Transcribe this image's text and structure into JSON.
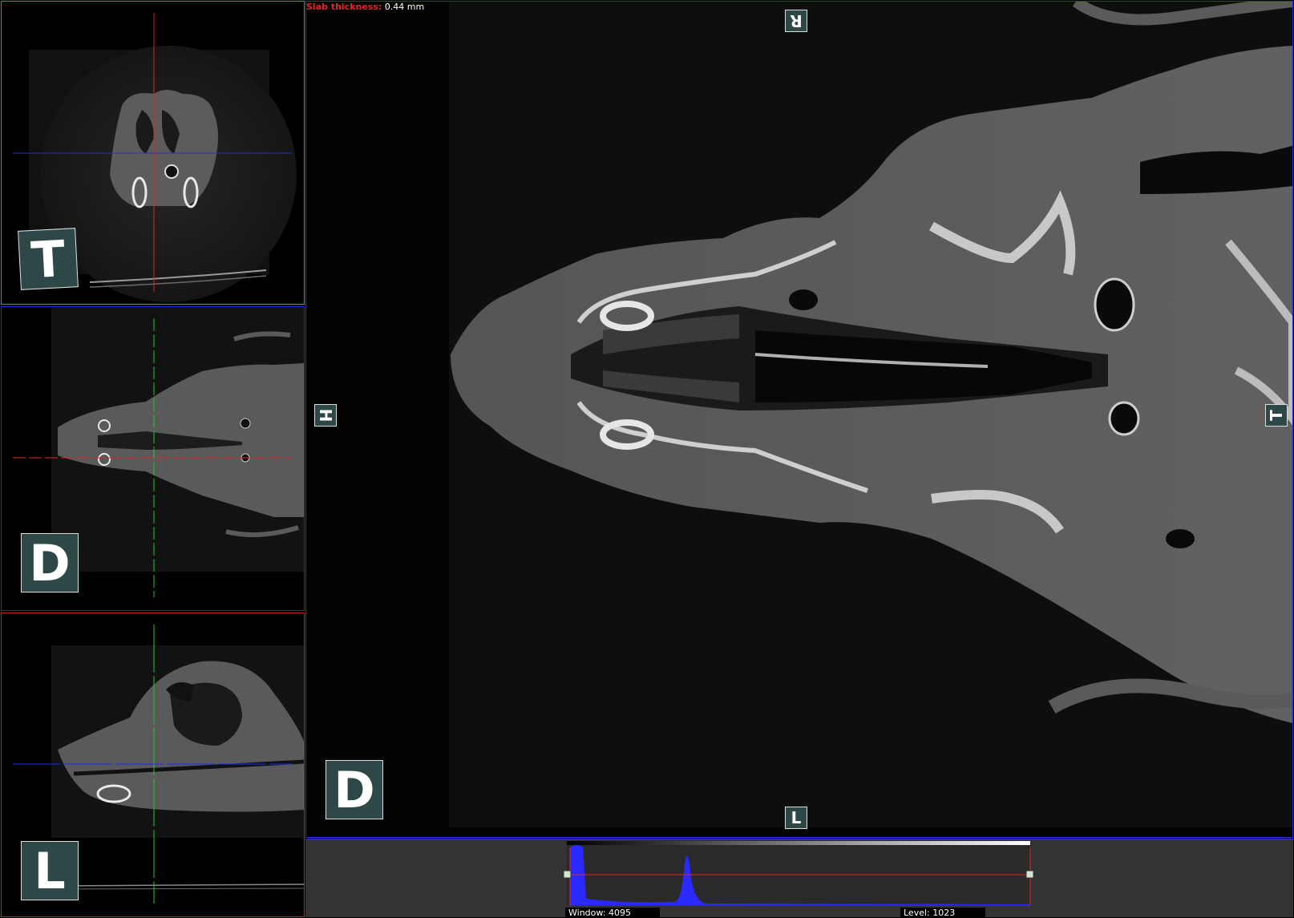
{
  "slab": {
    "label": "Slab thickness:",
    "value": "0.44 mm"
  },
  "viewports": {
    "axial": {
      "orientation_label": "T"
    },
    "dorsal": {
      "orientation_label": "D"
    },
    "lateral": {
      "orientation_label": "L"
    },
    "main": {
      "top_label": "R",
      "bottom_label": "L",
      "left_label": "H",
      "right_label": "T",
      "corner_label": "D"
    }
  },
  "histogram": {
    "window_label": "Window:",
    "window_value": "4095",
    "level_label": "Level:",
    "level_value": "1023"
  },
  "colors": {
    "axial_border": "#3aa14a",
    "dorsal_border": "#2b2bd6",
    "lateral_border": "#c8202a",
    "crosshair_red": "#e0242a",
    "crosshair_blue": "#2b2bd6",
    "crosshair_green": "#2fbf3a",
    "histogram_fill": "#2a2aff"
  }
}
